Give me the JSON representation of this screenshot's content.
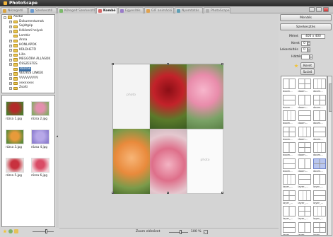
{
  "app": {
    "title": "PhotoScape"
  },
  "tabs": [
    {
      "label": "Nézegető",
      "color": "#d9a441"
    },
    {
      "label": "Szerkesztő",
      "color": "#6a9bd1"
    },
    {
      "label": "Kötegelt Szerkesztő",
      "color": "#7bb96a"
    },
    {
      "label": "Kombó",
      "color": "#d56767"
    },
    {
      "label": "Egyesítés",
      "color": "#9a7cc9"
    },
    {
      "label": "GIF animáció",
      "color": "#e0a24f"
    },
    {
      "label": "Nyomtatás",
      "color": "#5e9fb5"
    },
    {
      "label": "PhotoScape",
      "color": "#b0b0b0"
    }
  ],
  "active_tab": "Kombó",
  "tree": [
    {
      "label": "Asztal",
      "level": 0,
      "exp": "-"
    },
    {
      "label": "Dokumentumok",
      "level": 1,
      "exp": "+"
    },
    {
      "label": "Sajátgép",
      "level": 1,
      "exp": "+"
    },
    {
      "label": "Hálózati helyek",
      "level": 1,
      "exp": "+"
    },
    {
      "label": "Lomtár",
      "level": 1,
      "exp": ""
    },
    {
      "label": "Anna",
      "level": 1,
      "exp": "+"
    },
    {
      "label": "HONLAPOK",
      "level": 1,
      "exp": "+"
    },
    {
      "label": "KÜLDHETŐ",
      "level": 1,
      "exp": "+"
    },
    {
      "label": "Lilla",
      "level": 1,
      "exp": "+"
    },
    {
      "label": "MEGGÖRA ÁLLÁSOK",
      "level": 1,
      "exp": "+"
    },
    {
      "label": "ÖSSZESTES",
      "level": 1,
      "exp": "+"
    },
    {
      "label": "Rózsák",
      "level": 1,
      "exp": "",
      "selected": true
    },
    {
      "label": "VEGYES LINKEK",
      "level": 1,
      "exp": "+"
    },
    {
      "label": "VVVVVVVVV",
      "level": 1,
      "exp": "+"
    },
    {
      "label": "xxxxxxxx",
      "level": 1,
      "exp": "+"
    },
    {
      "label": "Zsolti",
      "level": 1,
      "exp": "+"
    }
  ],
  "thumbnails": [
    {
      "label": "rózsa 1.jpg",
      "c1": "#b32a2a",
      "c2": "#4d7a2c"
    },
    {
      "label": "rózsa 2.jpg",
      "c1": "#e38fae",
      "c2": "#8aa96a"
    },
    {
      "label": "rózsa 3.jpg",
      "c1": "#e79a3a",
      "c2": "#5f8a3a"
    },
    {
      "label": "rózsa 4.jpg",
      "c1": "#b7a8e8",
      "c2": "#8e7fd0"
    },
    {
      "label": "rózsa 5.jpg",
      "c1": "#c8313e",
      "c2": "#e8d8d8"
    },
    {
      "label": "rózsa 6.jpg",
      "c1": "#d94c66",
      "c2": "#f3d2d8"
    }
  ],
  "canvas": {
    "placeholder": "photo"
  },
  "status": {
    "zoom_label": "Zoom előnézet",
    "zoom_value": "100 %"
  },
  "right": {
    "save": "Mentés",
    "edit": "Szerkesztés",
    "size_label": "Méret",
    "size_value": "400 x 400",
    "frame_label": "Keret",
    "frame_value": "0",
    "rounding_label": "Lekerekítés",
    "rounding_value": "0",
    "bg_label": "Háttér",
    "frame_btn": "Keret",
    "filter_btn": "Szűrő",
    "layouts": [
      "doom...",
      "doom...",
      "doom...",
      "doom...",
      "doom...",
      "doom...",
      "doom...",
      "doom...",
      "doom...",
      "doom...",
      "doom...",
      "doom...",
      "doom...",
      "doom...",
      "doom...",
      "doom...",
      "doom...",
      "doom...",
      "layer_...",
      "layer_...",
      "layer_...",
      "layer_...",
      "layer_...",
      "layer_...",
      "layer_...",
      "layer_...",
      "layer_...",
      "layer_...",
      "layer_...",
      "layer_..."
    ],
    "selected_layout": 17
  }
}
